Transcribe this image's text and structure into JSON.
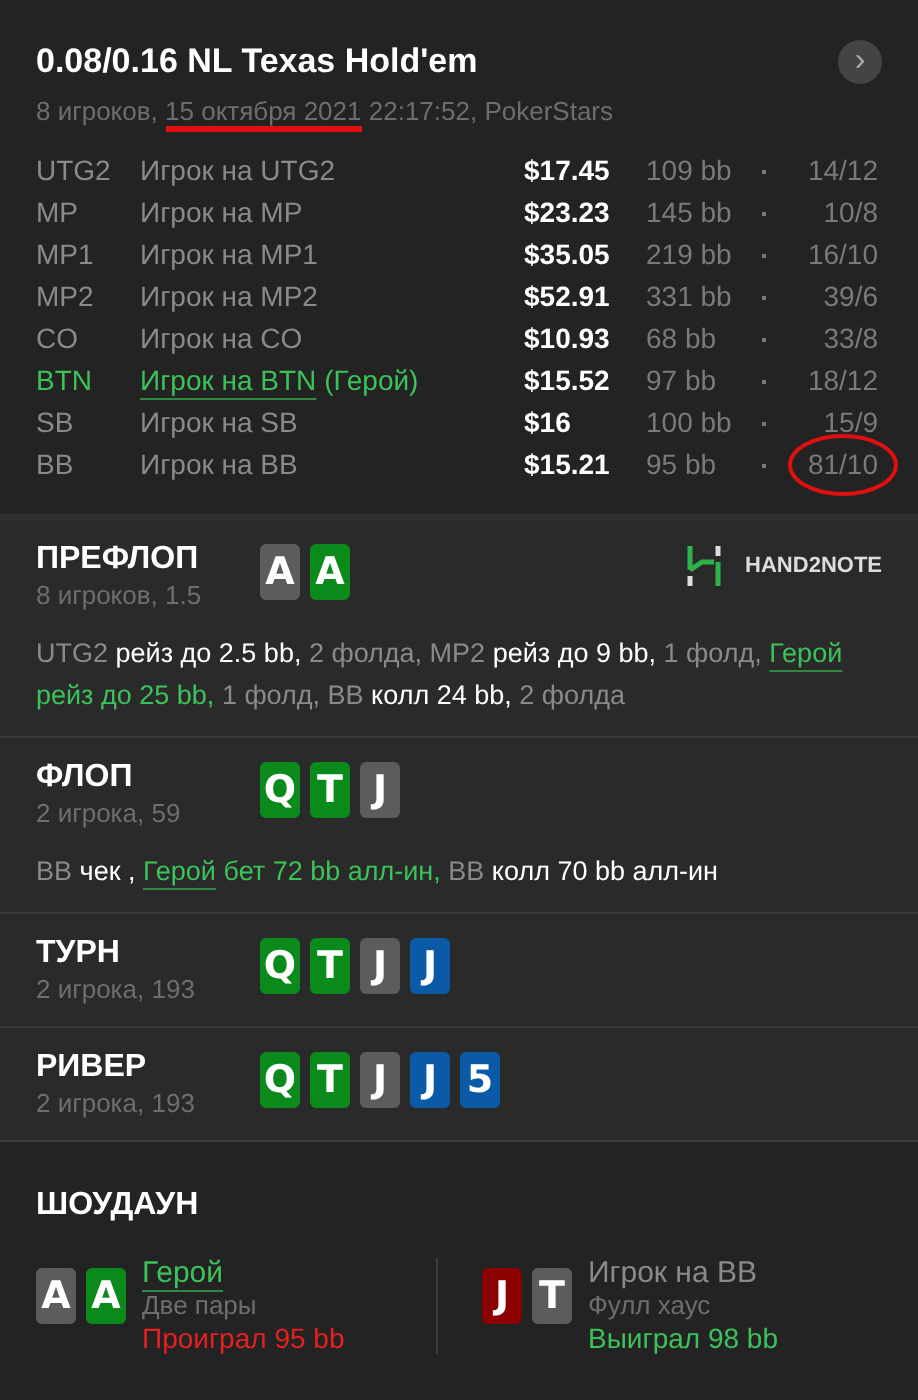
{
  "header": {
    "title": "0.08/0.16 NL Texas Hold'em",
    "players": "8 игроков,",
    "date": {
      "text": "15 октября 2021",
      "highlighted": true
    },
    "time_site": "22:17:52, PokerStars",
    "next_button": "›"
  },
  "players": [
    {
      "position": "UTG2",
      "name": "Игрок на UTG2",
      "hero": false,
      "stack": "$17.45",
      "bb": "109 bb",
      "stat": "14/12",
      "highlighted": false
    },
    {
      "position": "MP",
      "name": "Игрок на MP",
      "hero": false,
      "stack": "$23.23",
      "bb": "145 bb",
      "stat": "10/8",
      "highlighted": false
    },
    {
      "position": "MP1",
      "name": "Игрок на MP1",
      "hero": false,
      "stack": "$35.05",
      "bb": "219 bb",
      "stat": "16/10",
      "highlighted": false
    },
    {
      "position": "MP2",
      "name": "Игрок на MP2",
      "hero": false,
      "stack": "$52.91",
      "bb": "331 bb",
      "stat": "39/6",
      "highlighted": false
    },
    {
      "position": "CO",
      "name": "Игрок на CO",
      "hero": false,
      "stack": "$10.93",
      "bb": "68 bb",
      "stat": "33/8",
      "highlighted": false
    },
    {
      "position": "BTN",
      "name": "Игрок на BTN",
      "hero": true,
      "hero_tag": "(Герой)",
      "stack": "$15.52",
      "bb": "97 bb",
      "stat": "18/12",
      "highlighted": false
    },
    {
      "position": "SB",
      "name": "Игрок на SB",
      "hero": false,
      "stack": "$16",
      "bb": "100 bb",
      "stat": "15/9",
      "highlighted": false
    },
    {
      "position": "BB",
      "name": "Игрок на BB",
      "hero": false,
      "stack": "$15.21",
      "bb": "95 bb",
      "stat": "81/10",
      "highlighted": true
    }
  ],
  "streets": [
    {
      "title": "ПРЕФЛОП",
      "info": "8 игроков, 1.5",
      "logo": "HAND2NOTE",
      "cards": [
        {
          "rank": "A",
          "color": "#5c5c5c"
        },
        {
          "rank": "A",
          "color": "#0a8a1a"
        }
      ],
      "actions": [
        {
          "kind": "actor",
          "text": "UTG2"
        },
        {
          "kind": "action",
          "text": "рейз до 2.5 bb,"
        },
        {
          "kind": "fold",
          "text": "2 фолда, MP2"
        },
        {
          "kind": "action",
          "text": "рейз до 9 bb,"
        },
        {
          "kind": "fold",
          "text": "1 фолд,"
        },
        {
          "kind": "hero",
          "text": "Герой"
        },
        {
          "kind": "hero_action",
          "text": "рейз до 25 bb,"
        },
        {
          "kind": "fold",
          "text": "1 фолд, BB"
        },
        {
          "kind": "action",
          "text": "колл 24 bb,"
        },
        {
          "kind": "fold",
          "text": "2 фолда"
        }
      ]
    },
    {
      "title": "ФЛОП",
      "info": "2 игрока, 59",
      "cards": [
        {
          "rank": "Q",
          "color": "#0a8a1a"
        },
        {
          "rank": "T",
          "color": "#0a8a1a"
        },
        {
          "rank": "J",
          "color": "#5c5c5c"
        }
      ],
      "actions": [
        {
          "kind": "actor",
          "text": "BB"
        },
        {
          "kind": "action",
          "text": "чек ,"
        },
        {
          "kind": "hero",
          "text": "Герой"
        },
        {
          "kind": "hero_action",
          "text": "бет 72 bb алл-ин,"
        },
        {
          "kind": "actor",
          "text": "BB"
        },
        {
          "kind": "action",
          "text": "колл 70 bb алл-ин"
        }
      ]
    },
    {
      "title": "ТУРН",
      "info": "2 игрока, 193",
      "cards": [
        {
          "rank": "Q",
          "color": "#0a8a1a"
        },
        {
          "rank": "T",
          "color": "#0a8a1a"
        },
        {
          "rank": "J",
          "color": "#5c5c5c"
        },
        {
          "rank": "J",
          "color": "#0b5aa8"
        }
      ]
    },
    {
      "title": "РИВЕР",
      "info": "2 игрока, 193",
      "cards": [
        {
          "rank": "Q",
          "color": "#0a8a1a"
        },
        {
          "rank": "T",
          "color": "#0a8a1a"
        },
        {
          "rank": "J",
          "color": "#5c5c5c"
        },
        {
          "rank": "J",
          "color": "#0b5aa8"
        },
        {
          "rank": "5",
          "color": "#0b5aa8"
        }
      ]
    }
  ],
  "showdown": {
    "title": "ШОУДАУН",
    "hands": [
      {
        "cards": [
          {
            "rank": "A",
            "color": "#5c5c5c"
          },
          {
            "rank": "A",
            "color": "#0a8a1a"
          }
        ],
        "name": "Герой",
        "hero": true,
        "combo": "Две пары",
        "result": "Проиграл 95 bb",
        "won": false
      },
      {
        "cards": [
          {
            "rank": "J",
            "color": "#8b0000"
          },
          {
            "rank": "T",
            "color": "#5c5c5c"
          }
        ],
        "name": "Игрок на BB",
        "hero": false,
        "combo": "Фулл хаус",
        "result": "Выиграл 98 bb",
        "won": true
      }
    ]
  }
}
